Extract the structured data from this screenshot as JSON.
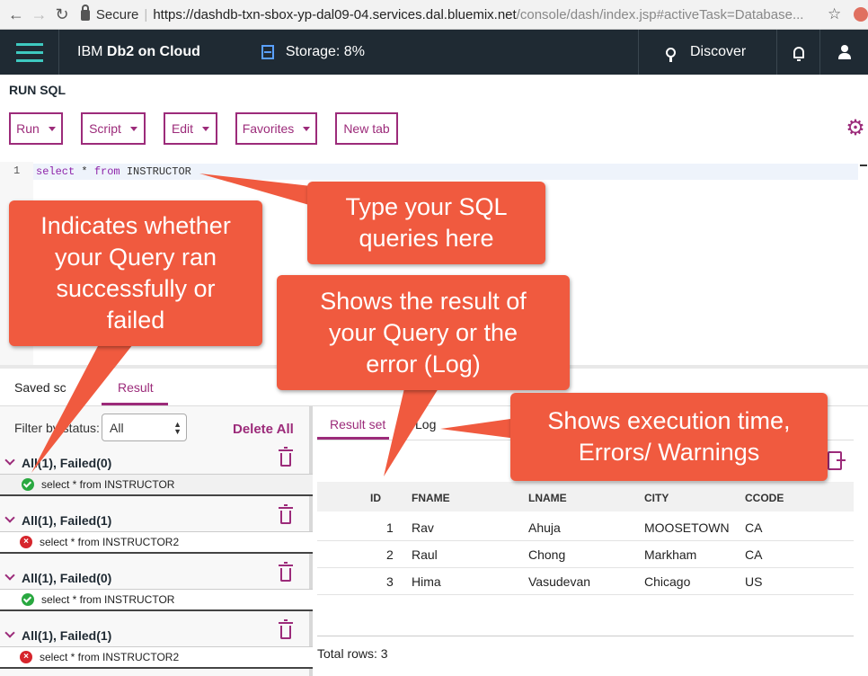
{
  "browser": {
    "secure_label": "Secure",
    "url_host": "https://dashdb-txn-sbox-yp-dal09-04.services.dal.bluemix.net",
    "url_path": "/console/dash/index.jsp#activeTask=Database..."
  },
  "header": {
    "brand_prefix": "IBM ",
    "brand_name": "Db2 on Cloud",
    "storage": "Storage: 8%",
    "discover": "Discover"
  },
  "page": {
    "title": "RUN SQL",
    "toolbar": {
      "run": "Run",
      "script": "Script",
      "edit": "Edit",
      "favorites": "Favorites",
      "new_tab": "New tab"
    }
  },
  "editor": {
    "line_number": "1",
    "code": {
      "kw1": "select",
      "mid": " * ",
      "kw2": "from",
      "rest": " INSTRUCTOR"
    }
  },
  "bottom_tabs": {
    "saved": "Saved sc",
    "result": "Result"
  },
  "history": {
    "filter_label": "Filter by status:",
    "filter_value": "All",
    "delete_all": "Delete All",
    "groups": [
      {
        "title": "All(1), Failed(0)",
        "status": "success",
        "query": "select * from INSTRUCTOR"
      },
      {
        "title": "All(1), Failed(1)",
        "status": "failed",
        "query": "select * from INSTRUCTOR2"
      },
      {
        "title": "All(1), Failed(0)",
        "status": "success",
        "query": "select * from INSTRUCTOR"
      },
      {
        "title": "All(1), Failed(1)",
        "status": "failed",
        "query": "select * from INSTRUCTOR2"
      }
    ]
  },
  "results": {
    "tabs": {
      "result_set": "Result set",
      "log": "Log"
    },
    "columns": [
      "ID",
      "FNAME",
      "LNAME",
      "CITY",
      "CCODE"
    ],
    "rows": [
      [
        "1",
        "Rav",
        "Ahuja",
        "MOOSETOWN",
        "CA"
      ],
      [
        "2",
        "Raul",
        "Chong",
        "Markham",
        "CA"
      ],
      [
        "3",
        "Hima",
        "Vasudevan",
        "Chicago",
        "US"
      ]
    ],
    "total": "Total rows: 3"
  },
  "callouts": {
    "sql": [
      "Type your SQL",
      "queries here"
    ],
    "status": [
      "Indicates whether",
      "your Query ran",
      "successfully or",
      "failed"
    ],
    "result": [
      "Shows the result of",
      "your Query or the",
      "error (Log)"
    ],
    "time": [
      "Shows execution time,",
      "Errors/ Warnings"
    ]
  },
  "colors": {
    "accent": "#9c2b7a",
    "header_bg": "#1f2a33",
    "callout": "#f05a3f",
    "success": "#29a840",
    "failed": "#d6252c"
  }
}
